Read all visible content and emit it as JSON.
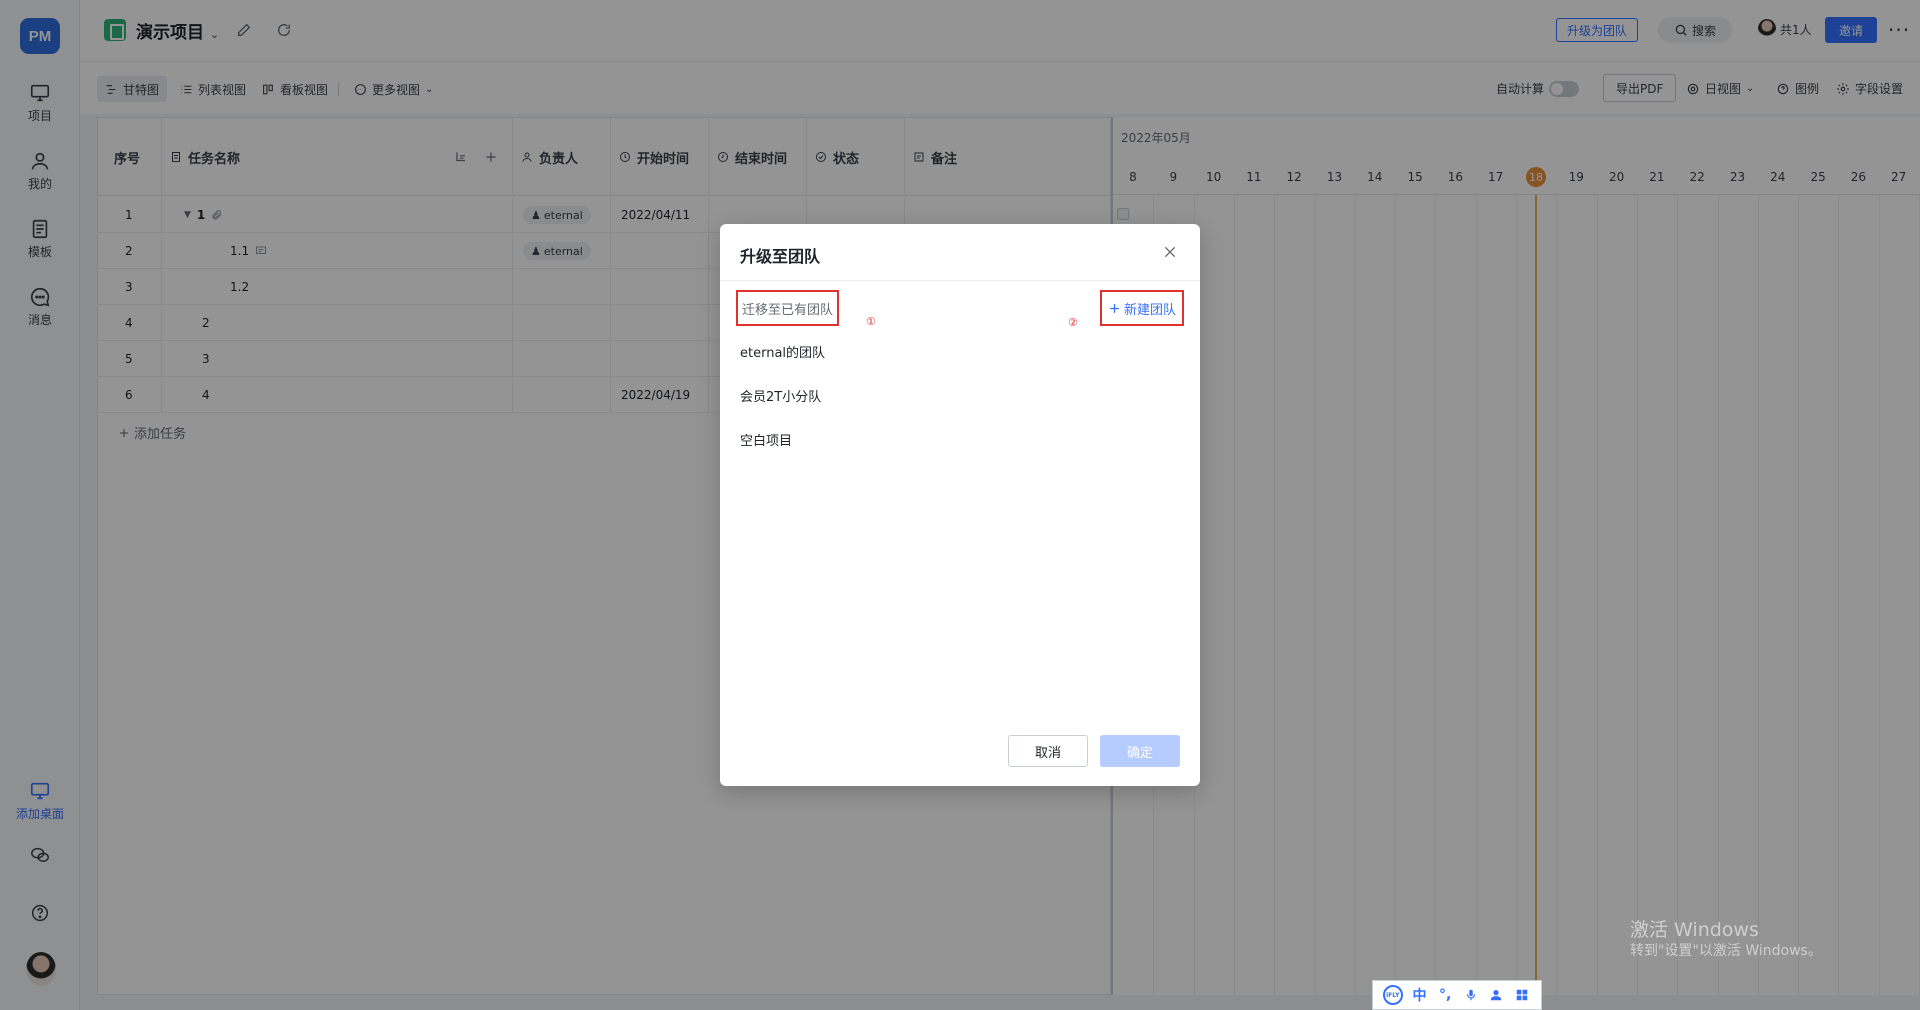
{
  "rail": {
    "logo": "PM",
    "items": [
      {
        "label": "项目",
        "icon": "monitor-icon"
      },
      {
        "label": "我的",
        "icon": "user-icon"
      },
      {
        "label": "模板",
        "icon": "template-icon"
      },
      {
        "label": "消息",
        "icon": "message-icon"
      }
    ],
    "add_desktop": "添加桌面"
  },
  "header": {
    "project_title": "演示项目",
    "upgrade": "升级为团队",
    "search": "搜索",
    "members": "共1人",
    "invite": "邀请",
    "more": "···"
  },
  "toolbar": {
    "views": [
      "甘特图",
      "列表视图",
      "看板视图",
      "更多视图"
    ],
    "auto_calc": "自动计算",
    "export_pdf": "导出PDF",
    "day_view": "日视图",
    "legend": "图例",
    "field_settings": "字段设置"
  },
  "grid": {
    "columns": [
      "序号",
      "任务名称",
      "负责人",
      "开始时间",
      "结束时间",
      "状态",
      "备注"
    ],
    "rows": [
      {
        "no": "1",
        "name": "1",
        "owner": "eternal",
        "start": "2022/04/11"
      },
      {
        "no": "2",
        "name": "1.1",
        "owner": "eternal",
        "start": ""
      },
      {
        "no": "3",
        "name": "1.2",
        "owner": "",
        "start": ""
      },
      {
        "no": "4",
        "name": "2",
        "owner": "",
        "start": ""
      },
      {
        "no": "5",
        "name": "3",
        "owner": "",
        "start": ""
      },
      {
        "no": "6",
        "name": "4",
        "owner": "",
        "start": "2022/04/19"
      }
    ],
    "add_task": "添加任务"
  },
  "gantt": {
    "month": "2022年05月",
    "days": [
      "8",
      "9",
      "10",
      "11",
      "12",
      "13",
      "14",
      "15",
      "16",
      "17",
      "18",
      "19",
      "20",
      "21",
      "22",
      "23",
      "24",
      "25",
      "26",
      "27"
    ],
    "today": "18"
  },
  "modal": {
    "title": "升级至团队",
    "migrate_label": "迁移至已有团队",
    "marker1": "①",
    "marker2": "②",
    "new_team": "新建团队",
    "teams": [
      "eternal的团队",
      "会员2T小分队",
      "空白项目"
    ],
    "cancel": "取消",
    "confirm": "确定"
  },
  "watermark": {
    "line1": "激活 Windows",
    "line2": "转到\"设置\"以激活 Windows。"
  },
  "ime": {
    "lang": "中"
  },
  "colors": {
    "accent": "#3370ff",
    "highlight_border": "#e03131",
    "today": "#e8903a",
    "overlay": "rgba(0,0,0,0.42)"
  }
}
